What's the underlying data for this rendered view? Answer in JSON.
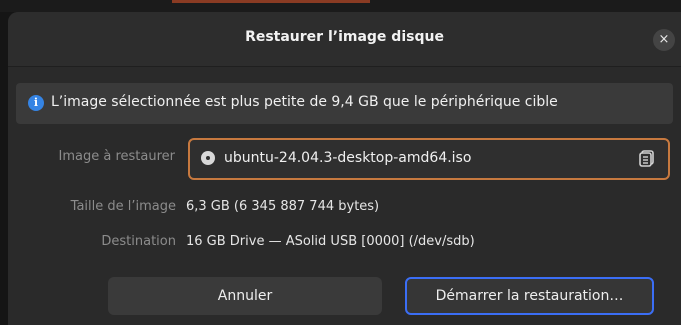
{
  "dialog": {
    "title": "Restaurer l’image disque",
    "close_label": "×"
  },
  "info": {
    "icon": "info-icon",
    "text": "L’image sélectionnée est plus petite de 9,4 GB que le périphérique cible"
  },
  "form": {
    "image_label": "Image à restaurer",
    "image_value": "ubuntu-24.04.3-desktop-amd64.iso",
    "size_label": "Taille de l’image",
    "size_value": "6,3 GB (6 345 887 744 bytes)",
    "destination_label": "Destination",
    "destination_value": "16 GB Drive — ASolid USB [0000] (/dev/sdb)"
  },
  "buttons": {
    "cancel": "Annuler",
    "start": "Démarrer la restauration…"
  },
  "colors": {
    "accent_border": "#c7793f",
    "focus_border": "#3b6ef5",
    "info_blue": "#3584e4"
  }
}
